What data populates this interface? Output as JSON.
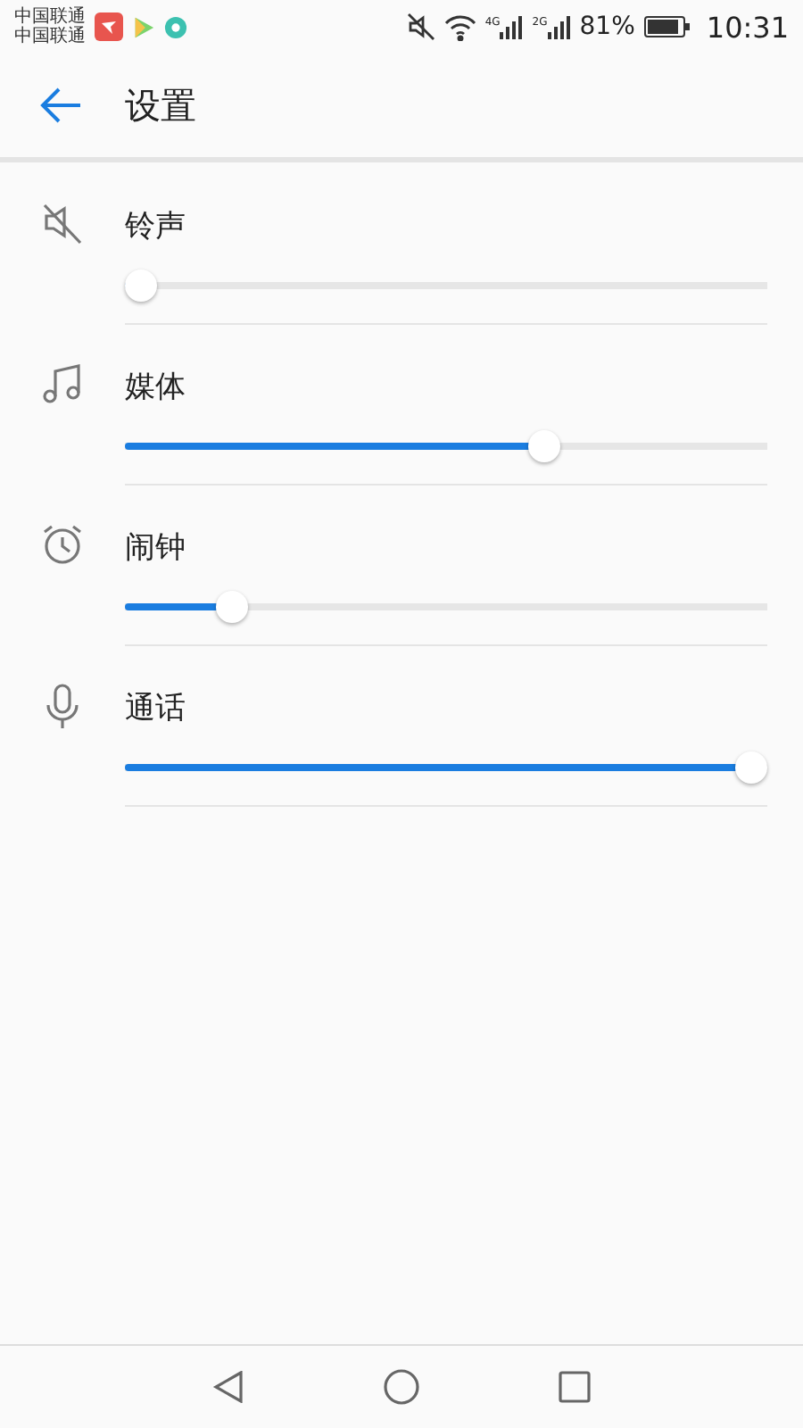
{
  "status_bar": {
    "carriers": [
      "中国联通",
      "中国联通"
    ],
    "network_labels": [
      "4G",
      "2G"
    ],
    "battery": "81%",
    "time": "10:31"
  },
  "header": {
    "title": "设置"
  },
  "channels": [
    {
      "kind": "ringtone",
      "name": "铃声",
      "level": 0
    },
    {
      "kind": "media",
      "name": "媒体",
      "level": 0.66
    },
    {
      "kind": "alarm",
      "name": "闹钟",
      "level": 0.15
    },
    {
      "kind": "call",
      "name": "通话",
      "level": 1
    }
  ]
}
